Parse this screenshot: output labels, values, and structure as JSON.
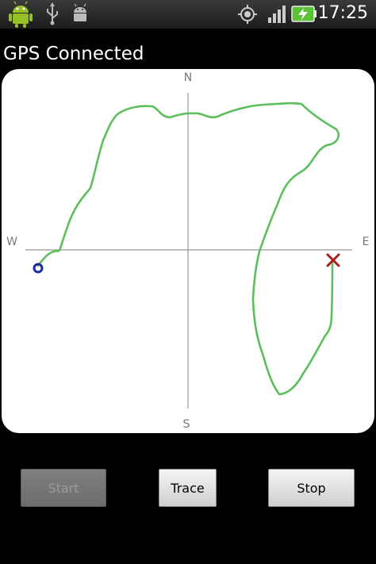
{
  "status_bar": {
    "time": "17:25",
    "icons": [
      "android-icon",
      "usb-icon",
      "debug-icon",
      "gps-icon",
      "signal-icon",
      "battery-charging-icon"
    ]
  },
  "title": "GPS Connected",
  "compass": {
    "north": "N",
    "south": "S",
    "east": "E",
    "west": "W"
  },
  "map": {
    "track_color": "#5cbf5c",
    "start_marker_color": "#1a2aa8",
    "end_marker_color": "#a51f1f",
    "axis_color": "#9a9a9a"
  },
  "buttons": {
    "start": {
      "label": "Start",
      "enabled": false
    },
    "trace": {
      "label": "Trace",
      "enabled": true
    },
    "stop": {
      "label": "Stop",
      "enabled": true
    }
  }
}
